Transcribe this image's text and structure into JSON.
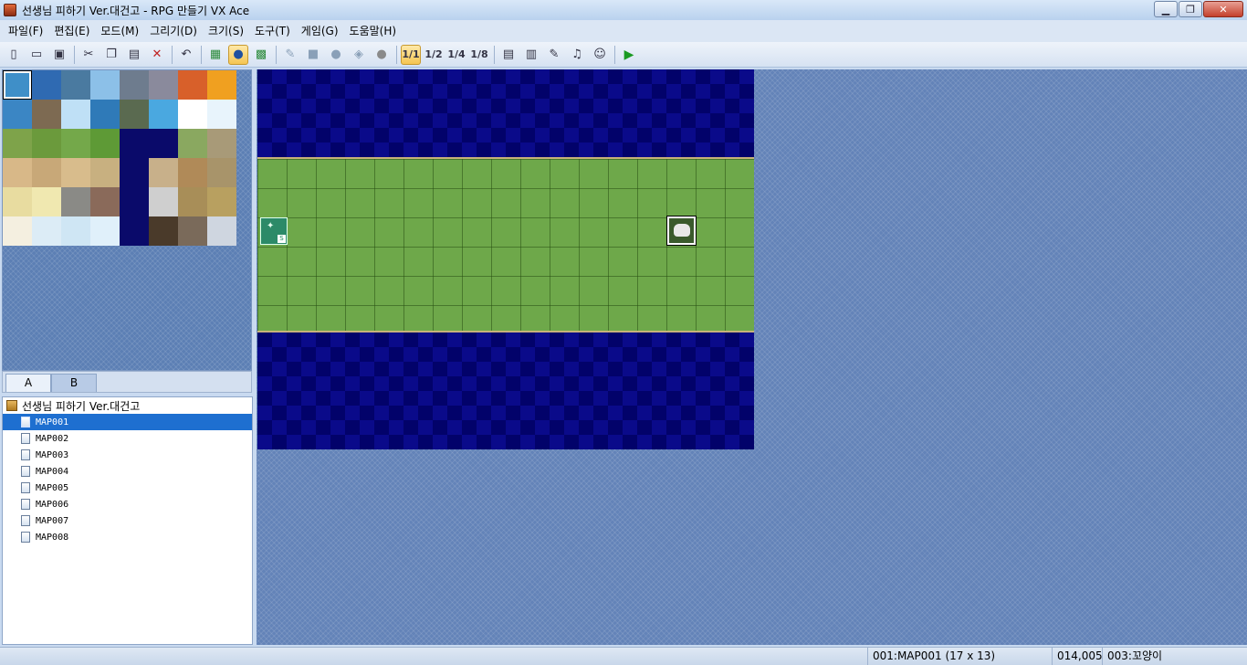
{
  "window": {
    "title": "선생님 피하기 Ver.대건고 - RPG 만들기 VX Ace",
    "minimize": "▁",
    "restore": "❐",
    "close": "✕"
  },
  "menu": [
    "파일(F)",
    "편집(E)",
    "모드(M)",
    "그리기(D)",
    "크기(S)",
    "도구(T)",
    "게임(G)",
    "도움말(H)"
  ],
  "toolbar": {
    "zoom_labels": [
      "1/1",
      "1/2",
      "1/4",
      "1/8"
    ]
  },
  "tileset": {
    "tabs": [
      "A",
      "B"
    ],
    "active_tab": "A",
    "tile_colors": [
      "#3f8fc8",
      "#2f6ab2",
      "#4a7aa0",
      "#8cc0e8",
      "#6e7c8e",
      "#8a8a9c",
      "#d8602a",
      "#f0a020",
      "#3b86c4",
      "#7d6a52",
      "#bfe0f6",
      "#2f7ab8",
      "#5a6a50",
      "#4aa8e0",
      "#ffffff",
      "#e8f4fc",
      "#7ea34a",
      "#6b9a3c",
      "#74a84a",
      "#5e9a36",
      "#0a0a6a",
      "#0a0a6a",
      "#8aa860",
      "#a89a78",
      "#d8b888",
      "#c8a878",
      "#d8bc8c",
      "#c8b080",
      "#0a0a6a",
      "#c8b08a",
      "#b08a58",
      "#a8946a",
      "#e8dca0",
      "#f0e8b0",
      "#8a8a86",
      "#8a6a5a",
      "#0a0a6a",
      "#cfcfcf",
      "#a88e58",
      "#b8a060",
      "#f4efe0",
      "#dcecf6",
      "#cfe6f4",
      "#e0f0fa",
      "#0a0a6a",
      "#4a3a2a",
      "#7a6a5a",
      "#cfd6e0"
    ]
  },
  "map_tree": {
    "project": "선생님 피하기 Ver.대건고",
    "maps": [
      "MAP001",
      "MAP002",
      "MAP003",
      "MAP004",
      "MAP005",
      "MAP006",
      "MAP007",
      "MAP008"
    ],
    "selected": "MAP001"
  },
  "map": {
    "start_label": "S"
  },
  "status": {
    "map_info": "001:MAP001 (17 x 13)",
    "coords": "014,005",
    "event": "003:꼬양이"
  }
}
